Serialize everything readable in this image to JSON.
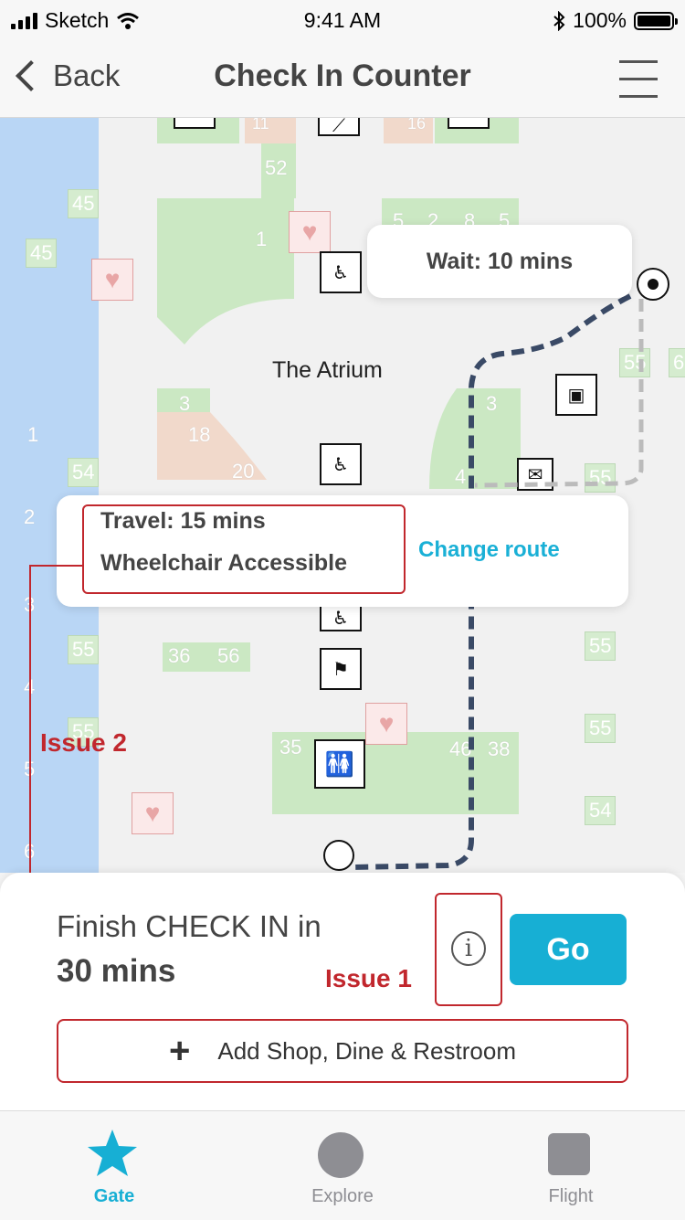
{
  "status_bar": {
    "carrier": "Sketch",
    "time": "9:41 AM",
    "battery": "100%"
  },
  "nav": {
    "back_label": "Back",
    "title": "Check In Counter"
  },
  "map": {
    "area_label": "The Atrium",
    "wait_label": "Wait: 10 mins",
    "travel_time": "Travel: 15 mins",
    "accessibility": "Wheelchair Accessible",
    "change_route": "Change route",
    "gate_numbers": [
      "45",
      "45",
      "52",
      "1",
      "5",
      "2",
      "8",
      "5",
      "55",
      "6",
      "3",
      "18",
      "3",
      "20",
      "54",
      "4",
      "55",
      "1",
      "2",
      "3",
      "4",
      "5",
      "6",
      "55",
      "36",
      "56",
      "55",
      "35",
      "46",
      "38",
      "55",
      "55",
      "54",
      "11",
      "16"
    ]
  },
  "annotations": {
    "issue_1": "Issue 1",
    "issue_2": "Issue 2"
  },
  "sheet": {
    "finish_label": "Finish CHECK IN in",
    "finish_time": "30 mins",
    "info_glyph": "i",
    "go_label": "Go",
    "add_label": "Add Shop, Dine & Restroom"
  },
  "tabs": [
    {
      "label": "Gate",
      "icon": "star-icon",
      "active": true
    },
    {
      "label": "Explore",
      "icon": "circle-icon",
      "active": false
    },
    {
      "label": "Flight",
      "icon": "square-icon",
      "active": false
    }
  ],
  "colors": {
    "accent": "#17afd4",
    "issue_red": "#c1272d",
    "route": "#3a4a66",
    "water": "#b9d6f5",
    "green_area": "#cbe8c3"
  }
}
